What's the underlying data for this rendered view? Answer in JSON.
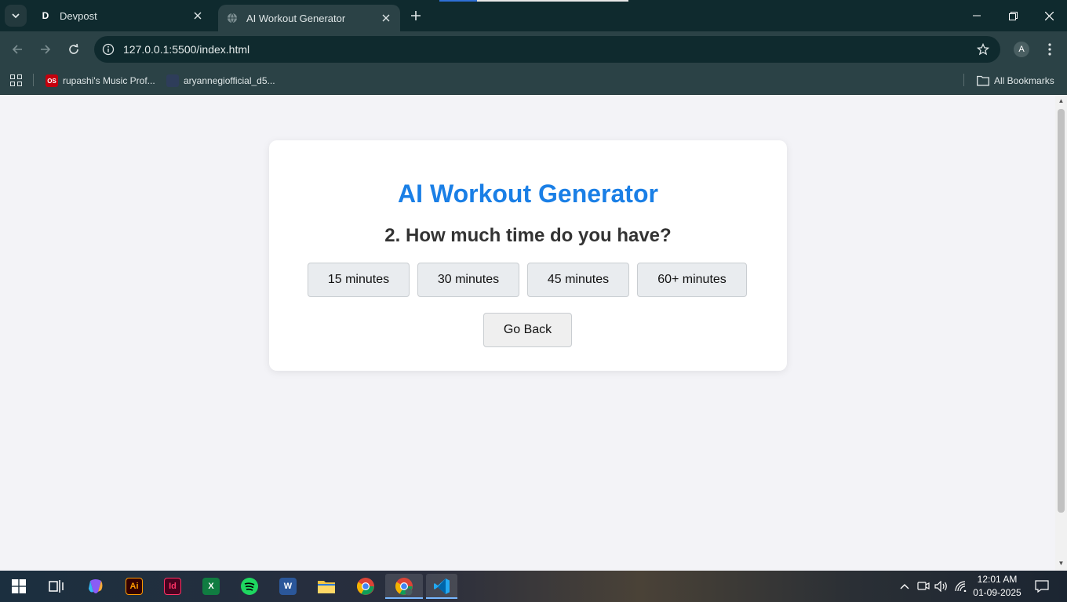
{
  "browser": {
    "tabs": [
      {
        "favicon_letter": "D",
        "title": "Devpost"
      },
      {
        "title": "AI Workout Generator"
      }
    ],
    "url": "127.0.0.1:5500/index.html",
    "profile_initial": "A",
    "bookmarks": [
      {
        "icon_text": "OS",
        "label": "rupashi's Music Prof..."
      },
      {
        "label": "aryannegiofficial_d5..."
      }
    ],
    "all_bookmarks_label": "All Bookmarks"
  },
  "page": {
    "title": "AI Workout Generator",
    "question": "2. How much time do you have?",
    "options": [
      "15 minutes",
      "30 minutes",
      "45 minutes",
      "60+ minutes"
    ],
    "back_label": "Go Back"
  },
  "taskbar": {
    "time": "12:01 AM",
    "date": "01-09-2025",
    "apps": [
      "start-icon",
      "task-view-icon",
      "copilot-icon",
      "illustrator-icon",
      "indesign-icon",
      "excel-icon",
      "spotify-icon",
      "word-icon",
      "file-explorer-icon",
      "chrome-icon",
      "chrome-profile-icon",
      "vscode-icon"
    ]
  },
  "colors": {
    "title_blue": "#1a7fe6",
    "question_text": "#333333",
    "page_bg": "#f3f3f7",
    "browser_frame": "#0f2a2e",
    "browser_toolbar": "#2b4246"
  }
}
